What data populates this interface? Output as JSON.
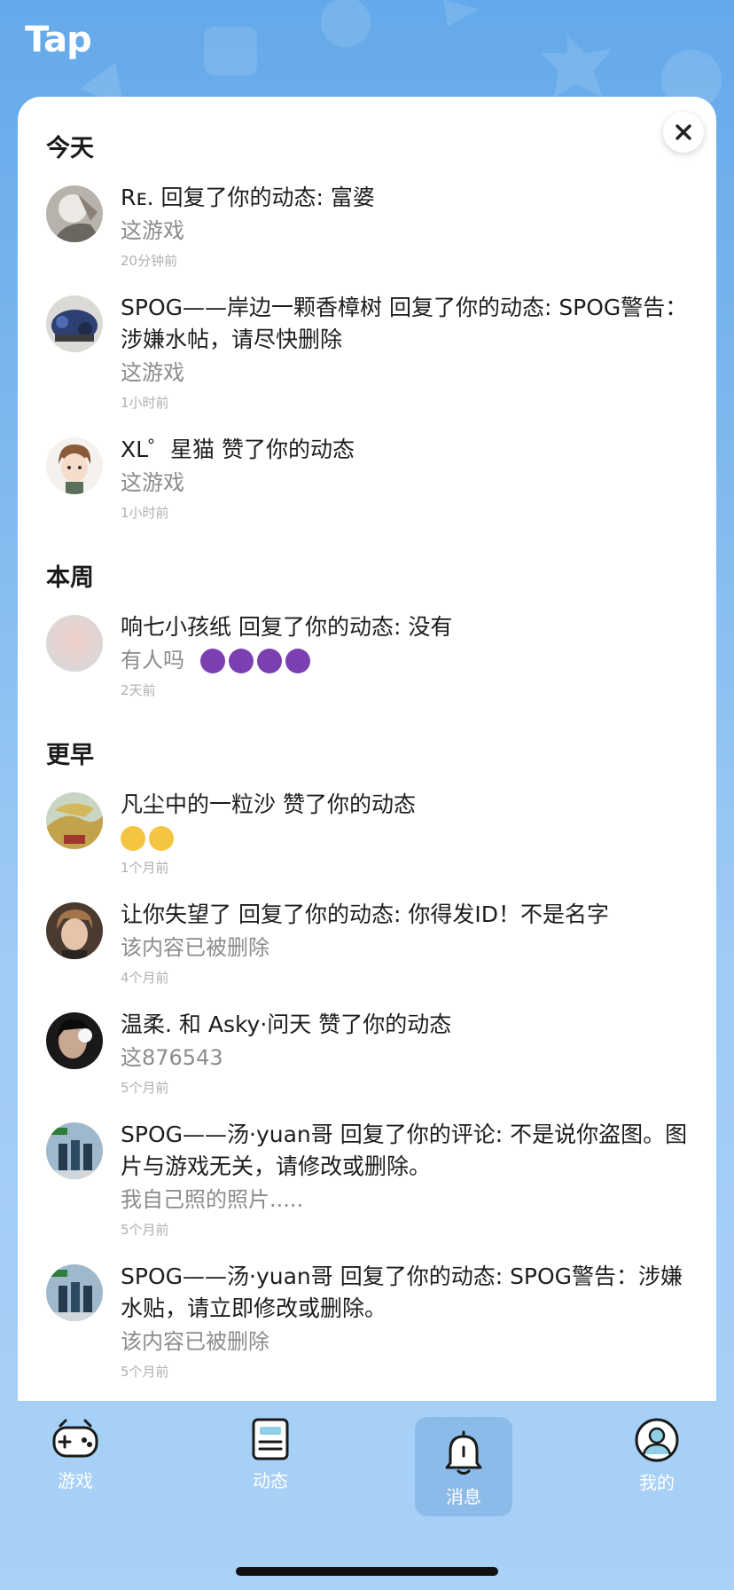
{
  "header": {
    "logo": "Tap"
  },
  "sections": {
    "today": "今天",
    "week": "本周",
    "earlier": "更早"
  },
  "notifications": [
    {
      "title": "Rᴇ. 回复了你的动态: 富婆",
      "sub": "这游戏",
      "time": "20分钟前"
    },
    {
      "title": "SPOG——岸边一颗香樟树 回复了你的动态: SPOG警告：涉嫌水帖，请尽快删除",
      "sub": "这游戏",
      "time": "1小时前"
    },
    {
      "title": "XL゜星猫 赞了你的动态",
      "sub": "这游戏",
      "time": "1小时前"
    },
    {
      "title": "响七小孩纸 回复了你的动态: 没有",
      "sub": "有人吗",
      "time": "2天前"
    },
    {
      "title": "凡尘中的一粒沙 赞了你的动态",
      "sub": "",
      "time": "1个月前"
    },
    {
      "title": "让你失望了 回复了你的动态: 你得发ID！不是名字",
      "sub": "该内容已被删除",
      "time": "4个月前"
    },
    {
      "title": "温柔. 和 Asky·问天 赞了你的动态",
      "sub": "这876543",
      "time": "5个月前"
    },
    {
      "title": "SPOG——汤·yuan哥 回复了你的评论: 不是说你盗图。图片与游戏无关，请修改或删除。",
      "sub": "我自己照的照片.....",
      "time": "5个月前"
    },
    {
      "title": "SPOG——汤·yuan哥 回复了你的动态: SPOG警告：涉嫌水贴，请立即修改或删除。",
      "sub": "该内容已被删除",
      "time": "5个月前"
    }
  ],
  "tabs": [
    {
      "label": "游戏",
      "icon": "gamepad-icon"
    },
    {
      "label": "动态",
      "icon": "feed-icon"
    },
    {
      "label": "消息",
      "icon": "bell-icon",
      "active": true
    },
    {
      "label": "我的",
      "icon": "profile-icon"
    }
  ],
  "colors": {
    "accent": "#64a9ea",
    "tabbar": "#a9d1f6"
  }
}
